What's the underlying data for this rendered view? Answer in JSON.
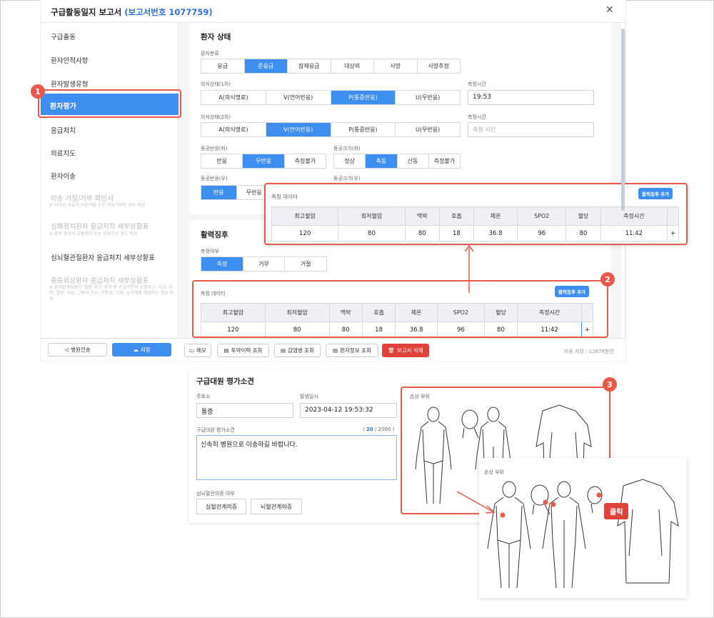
{
  "window": {
    "title": "구급활동일지 보고서",
    "report_no": "(보고서번호 1077759)",
    "close_icon": "close-icon"
  },
  "sidebar": {
    "items": [
      {
        "label": "구급출동"
      },
      {
        "label": "환자인적사항"
      },
      {
        "label": "환자발생유형"
      },
      {
        "label": "환자평가"
      },
      {
        "label": "응급처치"
      },
      {
        "label": "의료지도"
      },
      {
        "label": "환자이송"
      },
      {
        "label": "이송 거절/거부 확인서",
        "note": "※ 미이송 사유가 이송거절 또는 이송거부인 경우 작성"
      },
      {
        "label": "심폐정지환자 응급처치 세부상황표",
        "note": "※ 환자 증상이 호흡정지 또는 심정지인 경우 작성"
      },
      {
        "label": "심뇌혈관질환자 응급처치 세부상황표"
      },
      {
        "label": "중증외상환자 응급처치 세부상황표",
        "note": "※ 환자발생유형이 '질병 외'인 환자 중 손상기전이 교통사고, 낙상, 추락, 열상, 자상, 그밖의 둔상, 관통상, 기계, 농기계에 해당하는 경우 작성"
      }
    ],
    "transfer_btn": "병원전송",
    "save_btn": "저장"
  },
  "patient_status": {
    "title": "환자 상태",
    "class_label": "환자분류",
    "class_options": [
      "응급",
      "준응급",
      "잠재응급",
      "대상외",
      "사망",
      "사망추정"
    ],
    "class_selected": 1,
    "con1_label": "의식상태(1차)",
    "con2_label": "의식상태(2차)",
    "con_options": [
      "A(의식명료)",
      "V(언어반응)",
      "P(통증반응)",
      "U(무반응)"
    ],
    "con1_selected": 2,
    "con2_selected": 1,
    "time_label": "측정시간",
    "time1": "19:53",
    "time2_placeholder": "측정 시간",
    "pupil_l_label": "동공반응(좌)",
    "pupil_l_options": [
      "반응",
      "무반응",
      "측정불가"
    ],
    "pupil_l_selected": 1,
    "size_l_label": "동공크기(좌)",
    "size_l_options": [
      "정상",
      "축동",
      "산동",
      "측정불가"
    ],
    "size_l_selected": 1,
    "pupil_r_label": "동공반응(우)",
    "pupil_r_options": [
      "반응",
      "무반응"
    ],
    "pupil_r_selected": 0,
    "size_r_label": "동공크기(우)"
  },
  "vitals": {
    "title": "활력징후",
    "measure_label": "측정여부",
    "measure_options": [
      "측정",
      "거부",
      "거절"
    ],
    "measure_selected": 0,
    "data_label": "측정 데이터",
    "add_btn": "활력징후 추가",
    "headers": [
      "최고혈압",
      "최저혈압",
      "맥박",
      "호흡",
      "체온",
      "SPO2",
      "혈당",
      "측정시간"
    ],
    "row": [
      "120",
      "80",
      "80",
      "18",
      "36.8",
      "96",
      "80",
      "11:42"
    ],
    "plus": "+"
  },
  "toolbar": {
    "memo": "메모",
    "med_history": "투약이력 조회",
    "infection": "감염병 조회",
    "patient_info": "환자정보 조회",
    "delete": "보고서 삭제",
    "autosave": "자동 저장 : 12678분전"
  },
  "evaluation": {
    "title": "구급대원 평가소견",
    "chief_label": "주호소",
    "chief_value": "통증",
    "occur_label": "발생일시",
    "occur_value": "2023-04-12 19:53:32",
    "opinion_label": "구급대원 평가소견",
    "count_current": "20",
    "count_max": "2000",
    "opinion_text": "신속히 병원으로 이송하길 바랍니다.",
    "cv_label": "심뇌혈관의증 여부",
    "cv_options": [
      "심혈관계의증",
      "뇌혈관계의증"
    ],
    "injury_label": "손상 부위",
    "click_label": "클릭"
  },
  "callouts": [
    "1",
    "2",
    "3"
  ],
  "colors": {
    "accent": "#3e8ef0",
    "highlight": "#e8584b",
    "report_no": "#2f6fd6"
  }
}
